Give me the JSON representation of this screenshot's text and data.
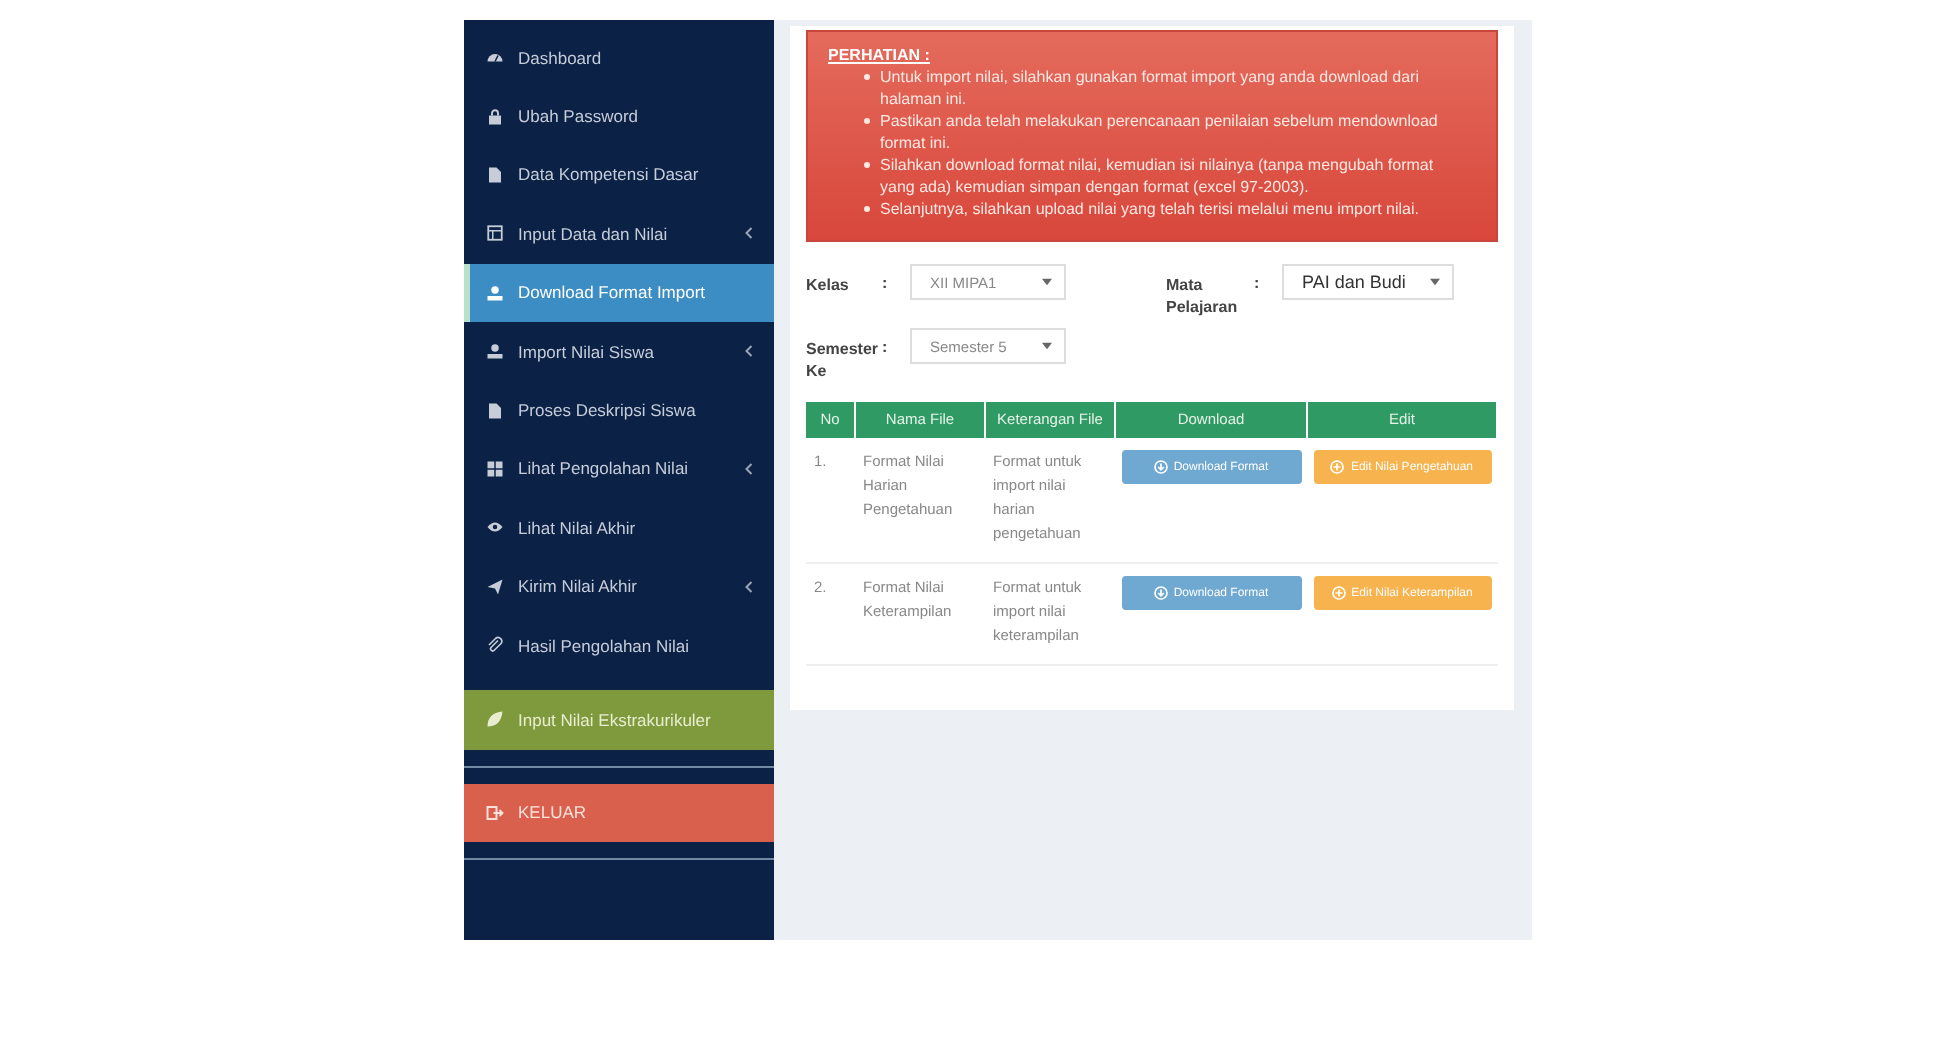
{
  "sidebar": {
    "items": [
      {
        "label": "Dashboard",
        "kind": "link",
        "selected": false,
        "has_submenu": false
      },
      {
        "label": "Ubah Password",
        "kind": "link",
        "selected": false,
        "has_submenu": false
      },
      {
        "label": "Data Kompetensi Dasar",
        "kind": "link",
        "selected": false,
        "has_submenu": false
      },
      {
        "label": "Input Data dan Nilai",
        "kind": "link",
        "selected": false,
        "has_submenu": true
      },
      {
        "label": "Download Format Import",
        "kind": "link",
        "selected": true,
        "has_submenu": false
      },
      {
        "label": "Import Nilai Siswa",
        "kind": "link",
        "selected": false,
        "has_submenu": true
      },
      {
        "label": "Proses Deskripsi Siswa",
        "kind": "link",
        "selected": false,
        "has_submenu": false
      },
      {
        "label": "Lihat Pengolahan Nilai",
        "kind": "link",
        "selected": false,
        "has_submenu": true
      },
      {
        "label": "Lihat Nilai Akhir",
        "kind": "link",
        "selected": false,
        "has_submenu": false
      },
      {
        "label": "Kirim Nilai Akhir",
        "kind": "link",
        "selected": false,
        "has_submenu": true
      },
      {
        "label": "Hasil Pengolahan Nilai",
        "kind": "link",
        "selected": false,
        "has_submenu": false
      },
      {
        "label": "Input Nilai Ekstrakurikuler",
        "kind": "accent",
        "selected": false,
        "has_submenu": false
      },
      {
        "label": "KELUAR",
        "kind": "danger",
        "selected": false,
        "has_submenu": false
      }
    ]
  },
  "alert": {
    "title": "PERHATIAN :",
    "points": [
      "Untuk import nilai, silahkan gunakan format import yang anda download dari halaman ini.",
      "Pastikan anda telah melakukan perencanaan penilaian sebelum mendownload format ini.",
      "Silahkan download format nilai, kemudian isi nilainya (tanpa mengubah format yang ada) kemudian simpan dengan format (excel 97-2003).",
      "Selanjutnya, silahkan upload nilai yang telah terisi melalui menu import nilai."
    ]
  },
  "filters": [
    {
      "label": "Kelas",
      "separator": ":",
      "value": "XII MIPA1"
    },
    {
      "label": "Mata Pelajaran",
      "separator": ":",
      "value": "PAI dan Budi"
    },
    {
      "label": "Semester Ke",
      "separator": ":",
      "value": "Semester 5"
    }
  ],
  "table": {
    "columns": [
      "No",
      "Nama File",
      "Keterangan File",
      "Download",
      "Edit"
    ],
    "rows": [
      {
        "no": "1.",
        "name": "Format Nilai Harian Pengetahuan",
        "description": "Format untuk import nilai harian pengetahuan",
        "download": "Download Format",
        "edit": "Edit Nilai Pengetahuan"
      },
      {
        "no": "2.",
        "name": "Format Nilai Keterampilan",
        "description": "Format untuk import nilai keterampilan",
        "download": "Download Format",
        "edit": "Edit Nilai Keterampilan"
      }
    ]
  }
}
